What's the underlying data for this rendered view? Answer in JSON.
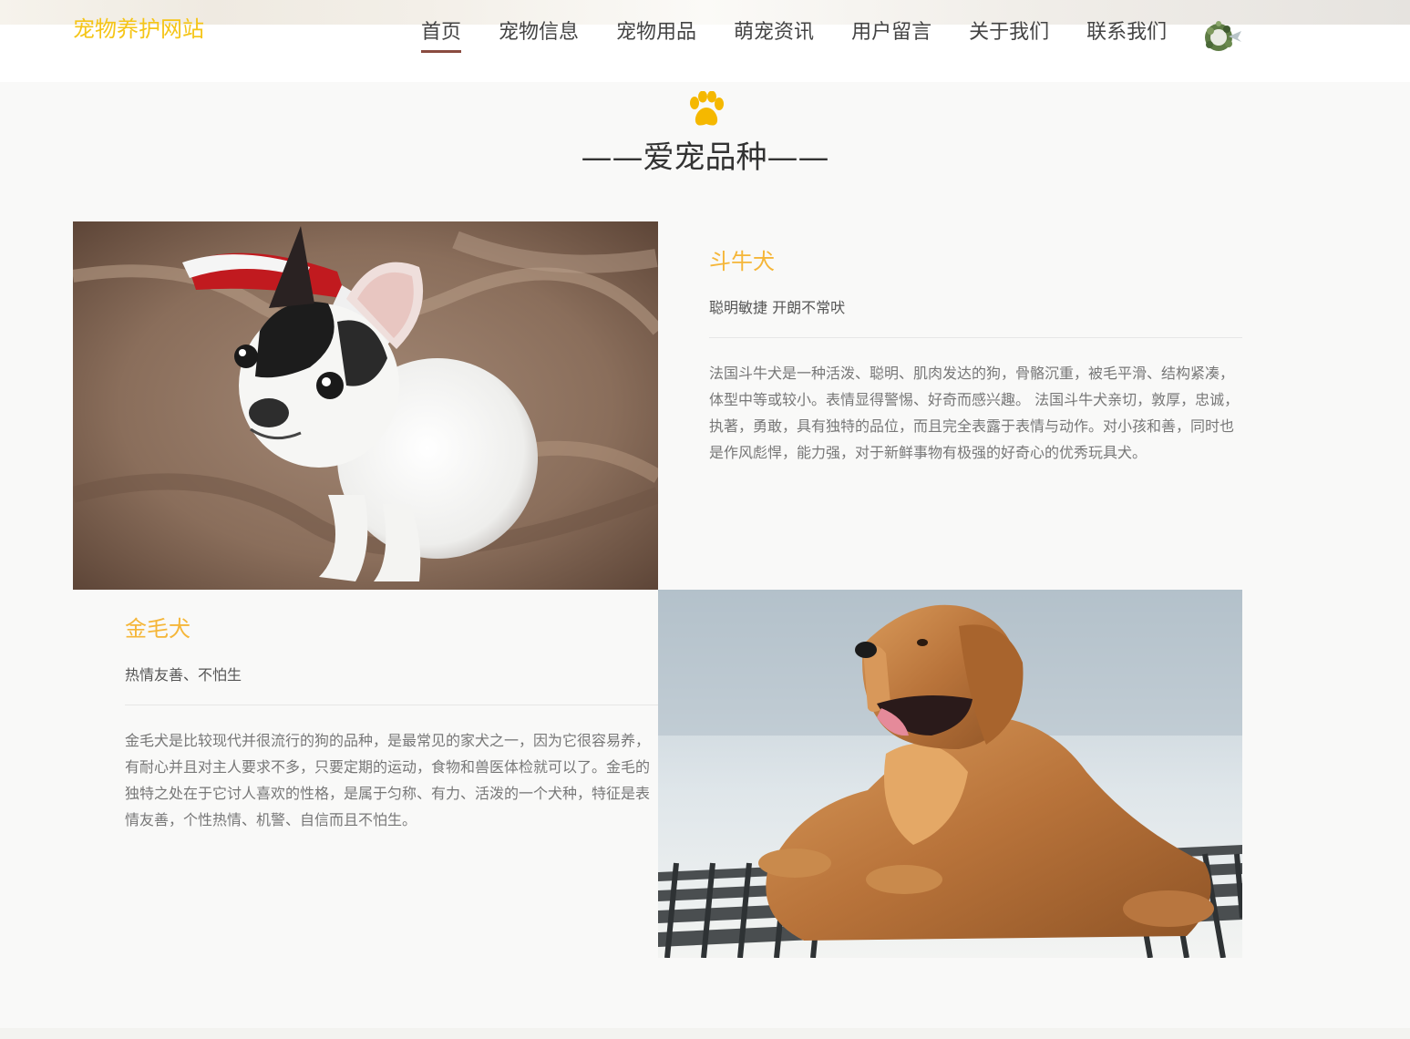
{
  "site": {
    "logo": "宠物养护网站"
  },
  "nav": {
    "items": [
      {
        "label": "首页",
        "active": true
      },
      {
        "label": "宠物信息",
        "active": false
      },
      {
        "label": "宠物用品",
        "active": false
      },
      {
        "label": "萌宠资讯",
        "active": false
      },
      {
        "label": "用户留言",
        "active": false
      },
      {
        "label": "关于我们",
        "active": false
      },
      {
        "label": "联系我们",
        "active": false
      }
    ]
  },
  "section": {
    "title": "——爱宠品种——",
    "paw_icon": "paw-icon"
  },
  "breeds": [
    {
      "name": "斗牛犬",
      "tagline": "聪明敏捷 开朗不常吠",
      "description": "法国斗牛犬是一种活泼、聪明、肌肉发达的狗，骨骼沉重，被毛平滑、结构紧凑，体型中等或较小。表情显得警惕、好奇而感兴趣。 法国斗牛犬亲切，敦厚，忠诚，执著，勇敢，具有独特的品位，而且完全表露于表情与动作。对小孩和善，同时也是作风彪悍，能力强，对于新鲜事物有极强的好奇心的优秀玩具犬。"
    },
    {
      "name": "金毛犬",
      "tagline": "热情友善、不怕生",
      "description": "金毛犬是比较现代并很流行的狗的品种，是最常见的家犬之一，因为它很容易养，有耐心并且对主人要求不多，只要定期的运动，食物和兽医体检就可以了。金毛的独特之处在于它讨人喜欢的性格，是属于匀称、有力、活泼的一个犬种，特征是表情友善，个性热情、机警、自信而且不怕生。"
    }
  ],
  "colors": {
    "accent": "#f5c518",
    "breed_title": "#f5b638",
    "active_underline": "#8a4b40",
    "background": "#f9f9f8"
  }
}
